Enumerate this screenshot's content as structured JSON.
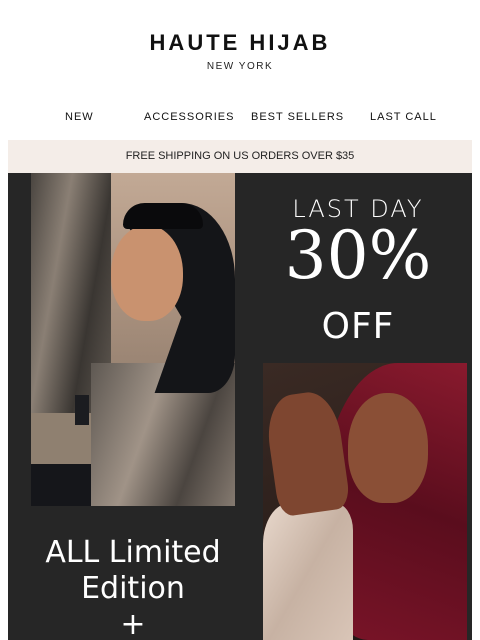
{
  "brand": {
    "name": "HAUTE HIJAB",
    "location": "NEW YORK"
  },
  "nav": {
    "items": [
      {
        "label": "NEW"
      },
      {
        "label": "ACCESSORIES"
      },
      {
        "label": "BEST SELLERS"
      },
      {
        "label": "LAST CALL"
      }
    ]
  },
  "banner": {
    "shipping": "FREE SHIPPING ON US ORDERS OVER $35"
  },
  "hero": {
    "headline_top": "LAST DAY",
    "discount": "30%",
    "discount_suffix": "OFF",
    "promo_line1": "ALL Limited",
    "promo_line2": "Edition",
    "promo_line3": "+"
  },
  "colors": {
    "hero_background": "#262626",
    "shipping_bar": "#f4ede8"
  }
}
